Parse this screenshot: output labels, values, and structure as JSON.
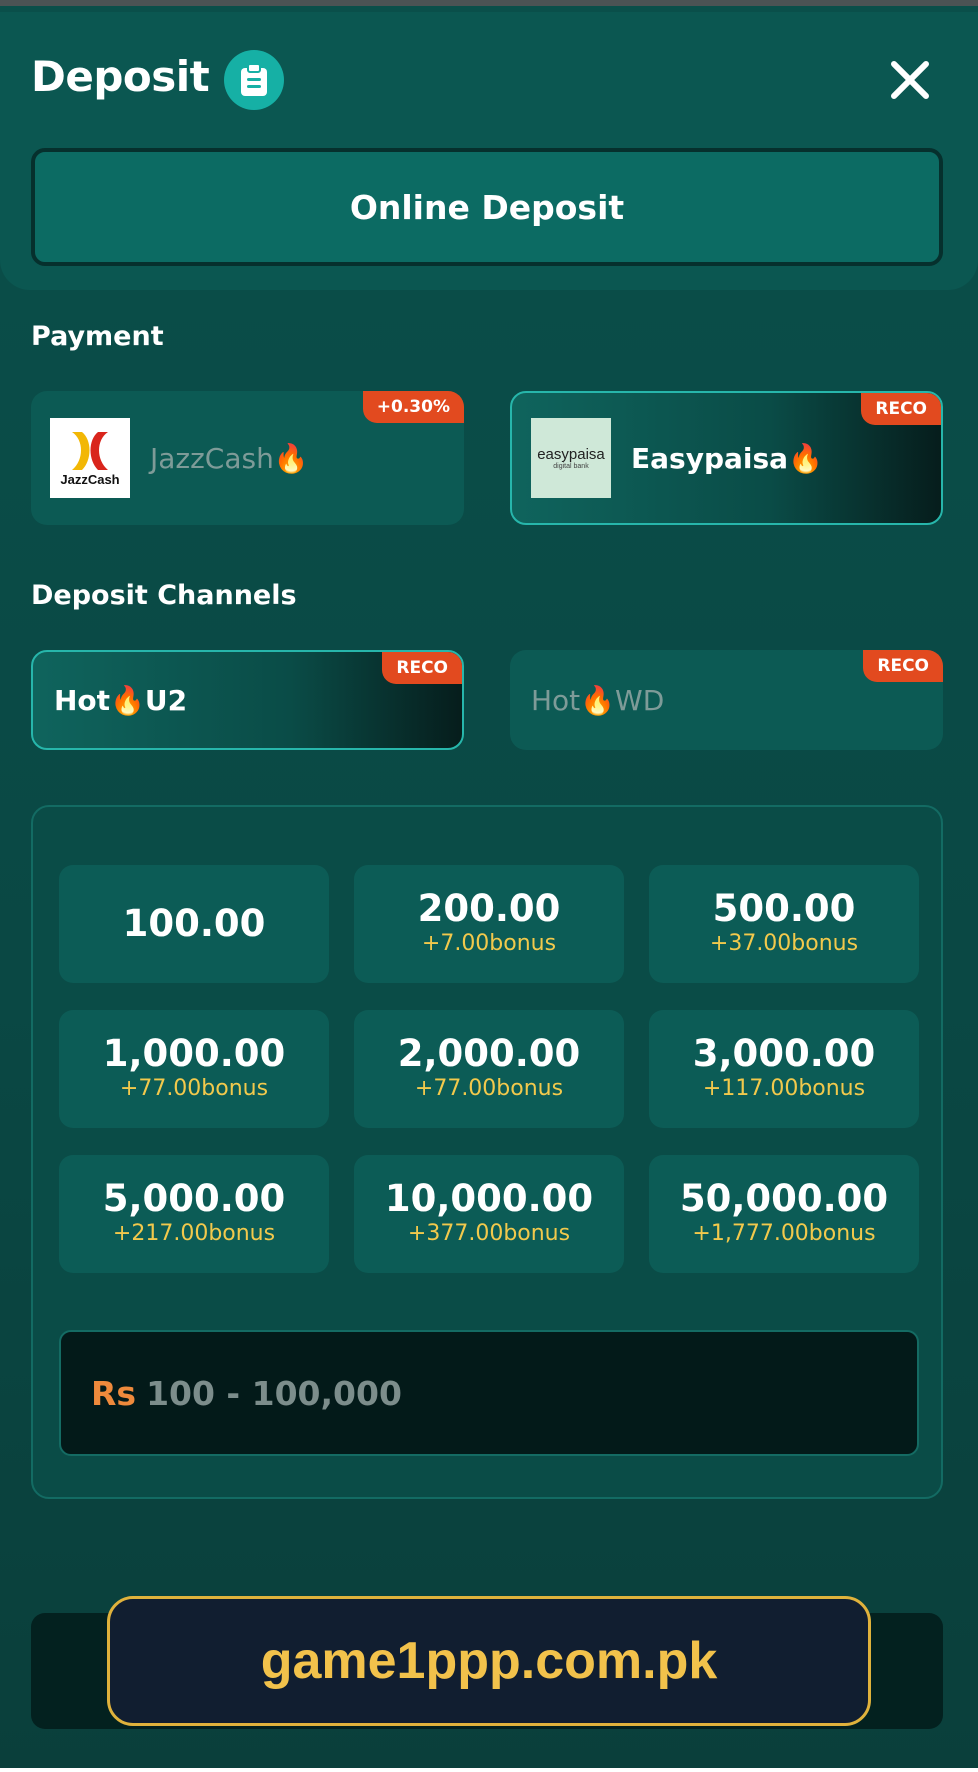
{
  "header": {
    "title": "Deposit",
    "clipboard_icon": "clipboard-icon",
    "close_icon": "close-icon"
  },
  "tabs": {
    "online_deposit": "Online Deposit"
  },
  "payment": {
    "section_title": "Payment",
    "methods": [
      {
        "name": "JazzCash🔥",
        "logo_text": "JazzCash",
        "badge": "+0.30%",
        "selected": false
      },
      {
        "name": "Easypaisa🔥",
        "logo_text": "easypaisa",
        "logo_subtext": "digital bank",
        "badge": "RECO",
        "selected": true
      }
    ]
  },
  "channels": {
    "section_title": "Deposit Channels",
    "items": [
      {
        "name": "Hot🔥U2",
        "badge": "RECO",
        "selected": true
      },
      {
        "name": "Hot🔥WD",
        "badge": "RECO",
        "selected": false
      }
    ]
  },
  "amounts": [
    {
      "value": "100.00",
      "bonus": ""
    },
    {
      "value": "200.00",
      "bonus": "+7.00bonus"
    },
    {
      "value": "500.00",
      "bonus": "+37.00bonus"
    },
    {
      "value": "1,000.00",
      "bonus": "+77.00bonus"
    },
    {
      "value": "2,000.00",
      "bonus": "+77.00bonus"
    },
    {
      "value": "3,000.00",
      "bonus": "+117.00bonus"
    },
    {
      "value": "5,000.00",
      "bonus": "+217.00bonus"
    },
    {
      "value": "10,000.00",
      "bonus": "+377.00bonus"
    },
    {
      "value": "50,000.00",
      "bonus": "+1,777.00bonus"
    }
  ],
  "amount_input": {
    "currency": "Rs",
    "placeholder": "100 - 100,000"
  },
  "watermark": {
    "text": "game1ppp.com.pk"
  },
  "colors": {
    "accent": "#16b0a5",
    "badge": "#e24a1f",
    "bonus": "#f2c94c",
    "currency": "#ee8a3c",
    "watermark": "#f2c24b"
  }
}
